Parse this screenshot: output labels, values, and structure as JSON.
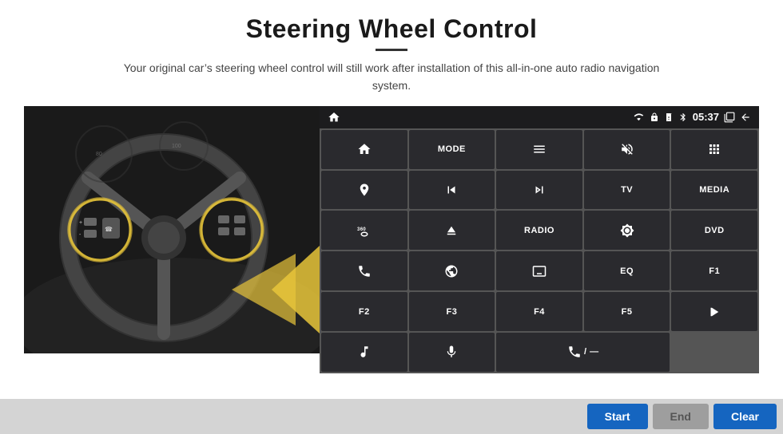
{
  "header": {
    "title": "Steering Wheel Control",
    "subtitle": "Your original car’s steering wheel control will still work after installation of this all-in-one auto radio navigation system."
  },
  "status_bar": {
    "time": "05:37",
    "icons": [
      "wifi",
      "lock",
      "sim",
      "bluetooth",
      "screenshot",
      "back"
    ]
  },
  "grid_buttons": [
    {
      "id": "home",
      "type": "icon",
      "icon": "home"
    },
    {
      "id": "mode",
      "type": "text",
      "label": "MODE"
    },
    {
      "id": "menu",
      "type": "icon",
      "icon": "menu"
    },
    {
      "id": "mute",
      "type": "icon",
      "icon": "mute"
    },
    {
      "id": "apps",
      "type": "icon",
      "icon": "apps"
    },
    {
      "id": "nav",
      "type": "icon",
      "icon": "navigate"
    },
    {
      "id": "prev",
      "type": "icon",
      "icon": "prev"
    },
    {
      "id": "next",
      "type": "icon",
      "icon": "next"
    },
    {
      "id": "tv",
      "type": "text",
      "label": "TV"
    },
    {
      "id": "media",
      "type": "text",
      "label": "MEDIA"
    },
    {
      "id": "camera360",
      "type": "icon",
      "icon": "360cam"
    },
    {
      "id": "eject",
      "type": "icon",
      "icon": "eject"
    },
    {
      "id": "radio",
      "type": "text",
      "label": "RADIO"
    },
    {
      "id": "brightness",
      "type": "icon",
      "icon": "brightness"
    },
    {
      "id": "dvd",
      "type": "text",
      "label": "DVD"
    },
    {
      "id": "phone",
      "type": "icon",
      "icon": "phone"
    },
    {
      "id": "gps",
      "type": "icon",
      "icon": "gps"
    },
    {
      "id": "screen",
      "type": "icon",
      "icon": "screen"
    },
    {
      "id": "eq",
      "type": "text",
      "label": "EQ"
    },
    {
      "id": "f1",
      "type": "text",
      "label": "F1"
    },
    {
      "id": "f2",
      "type": "text",
      "label": "F2"
    },
    {
      "id": "f3",
      "type": "text",
      "label": "F3"
    },
    {
      "id": "f4",
      "type": "text",
      "label": "F4"
    },
    {
      "id": "f5",
      "type": "text",
      "label": "F5"
    },
    {
      "id": "playpause",
      "type": "icon",
      "icon": "playpause"
    },
    {
      "id": "music",
      "type": "icon",
      "icon": "music"
    },
    {
      "id": "mic",
      "type": "icon",
      "icon": "mic"
    },
    {
      "id": "call",
      "type": "icon",
      "icon": "call"
    }
  ],
  "action_buttons": {
    "start": "Start",
    "end": "End",
    "clear": "Clear"
  },
  "colors": {
    "primary_btn": "#1565c0",
    "disabled_btn": "#9e9e9e",
    "panel_bg": "#1c1c1e",
    "grid_btn_bg": "#2a2a2e"
  }
}
